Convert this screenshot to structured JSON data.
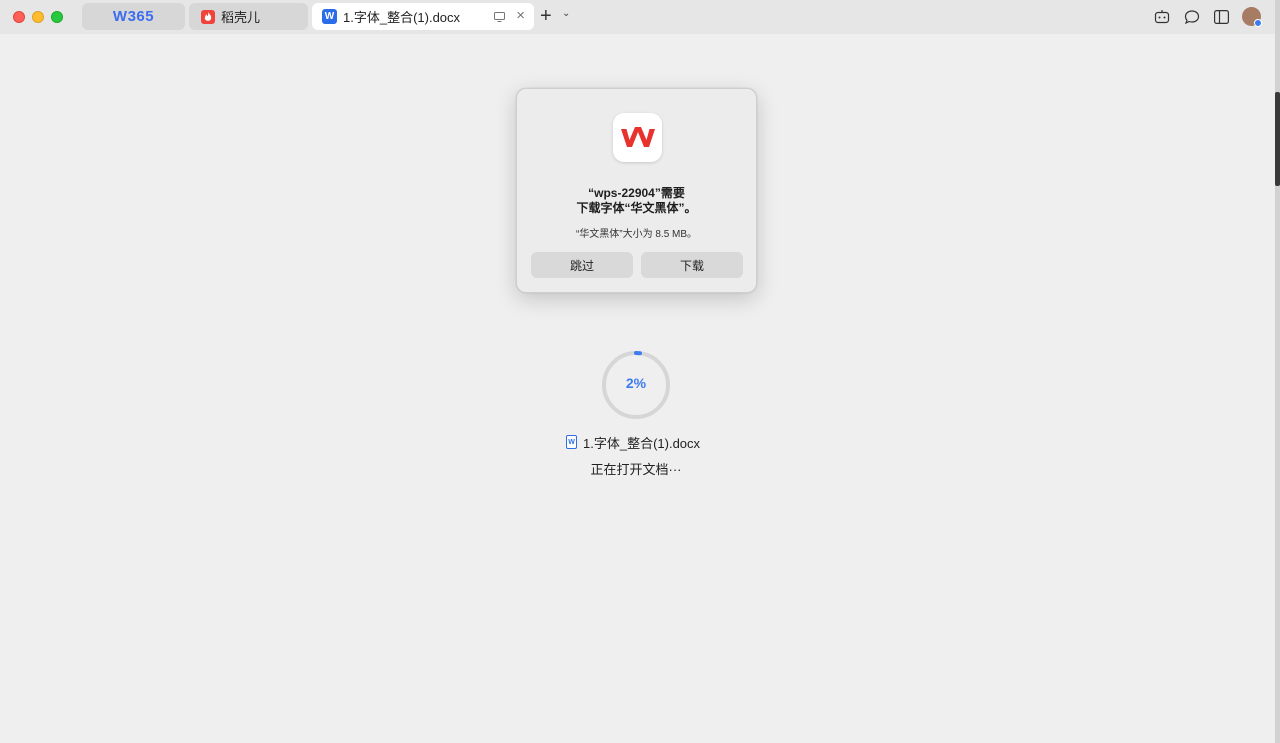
{
  "tabs": [
    {
      "label": "W365",
      "kind": "home"
    },
    {
      "label": "稻壳儿",
      "kind": "docer"
    },
    {
      "label": "1.字体_整合(1).docx",
      "kind": "document",
      "active": true
    }
  ],
  "tab_icon_letter": "W",
  "toolbar": {
    "new_tab": "+",
    "new_tab_menu": "⌄"
  },
  "dialog": {
    "title_line1": "“wps-22904”需要",
    "title_line2": "下载字体“华文黑体”。",
    "message": "“华文黑体”大小为 8.5 MB。",
    "skip_label": "跳过",
    "download_label": "下载"
  },
  "loading": {
    "percent_text": "2%",
    "progress": 0.02,
    "file_name": "1.字体_整合(1).docx",
    "file_icon_letter": "W",
    "status": "正在打开文档···"
  },
  "colors": {
    "accent": "#3d7cf0",
    "wps_red": "#e8322e",
    "window_bg": "#efefef",
    "titlebar_bg": "#e6e6e6"
  },
  "icons": {
    "toolbar_right": [
      "ai-assistant-icon",
      "chat-bubble-icon",
      "sidebar-toggle-icon",
      "user-avatar"
    ]
  }
}
